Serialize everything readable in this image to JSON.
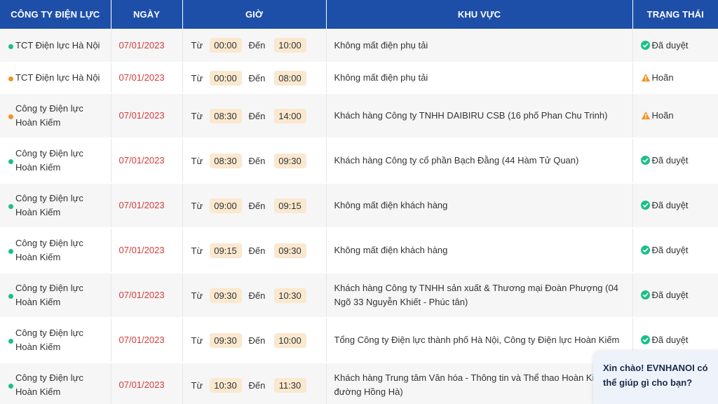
{
  "header": {
    "company": "CÔNG TY ĐIỆN LỰC",
    "date": "NGÀY",
    "time": "GIỜ",
    "area": "KHU VỰC",
    "status": "TRẠNG THÁI"
  },
  "labels": {
    "from": "Từ",
    "to": "Đến"
  },
  "colors": {
    "approved": "#1bbf88",
    "postponed": "#f29322",
    "header_bg": "#1e4fa8",
    "date": "#d63a3a"
  },
  "rows": [
    {
      "company": "TCT Điện lực Hà Nội",
      "dot": "approved",
      "date": "07/01/2023",
      "from": "00:00",
      "to": "10:00",
      "area": "Không mất điện phụ tải",
      "status": "Đã duyệt",
      "status_type": "approved"
    },
    {
      "company": "TCT Điện lực Hà Nội",
      "dot": "postponed",
      "date": "07/01/2023",
      "from": "00:00",
      "to": "08:00",
      "area": "Không mất điện phụ tải",
      "status": "Hoãn",
      "status_type": "postponed"
    },
    {
      "company": "Công ty Điện lực Hoàn Kiếm",
      "dot": "postponed",
      "date": "07/01/2023",
      "from": "08:30",
      "to": "14:00",
      "area": "Khách hàng Công ty TNHH DAIBIRU CSB (16 phố Phan Chu Trinh)",
      "status": "Hoãn",
      "status_type": "postponed"
    },
    {
      "company": "Công ty Điện lực Hoàn Kiếm",
      "dot": "approved",
      "date": "07/01/2023",
      "from": "08:30",
      "to": "09:30",
      "area": "Khách hàng Công ty cổ phần Bạch Đằng (44 Hàm Tử Quan)",
      "status": "Đã duyệt",
      "status_type": "approved"
    },
    {
      "company": "Công ty Điện lực Hoàn Kiếm",
      "dot": "approved",
      "date": "07/01/2023",
      "from": "09:00",
      "to": "09:15",
      "area": "Không mất điện khách hàng",
      "status": "Đã duyệt",
      "status_type": "approved"
    },
    {
      "company": "Công ty Điện lực Hoàn Kiếm",
      "dot": "approved",
      "date": "07/01/2023",
      "from": "09:15",
      "to": "09:30",
      "area": "Không mất điện khách hàng",
      "status": "Đã duyệt",
      "status_type": "approved"
    },
    {
      "company": "Công ty Điện lực Hoàn Kiếm",
      "dot": "approved",
      "date": "07/01/2023",
      "from": "09:30",
      "to": "10:30",
      "area": "Khách hàng Công ty TNHH sản xuất & Thương mại Đoàn Phượng (04 Ngõ 33 Nguyễn Khiết - Phúc tân)",
      "status": "Đã duyệt",
      "status_type": "approved"
    },
    {
      "company": "Công ty Điện lực Hoàn Kiếm",
      "dot": "approved",
      "date": "07/01/2023",
      "from": "09:30",
      "to": "10:00",
      "area": "Tổng Công ty Điện lực thành phố Hà Nội, Công ty Điện lực Hoàn Kiếm",
      "status": "Đã duyệt",
      "status_type": "approved"
    },
    {
      "company": "Công ty Điện lực Hoàn Kiếm",
      "dot": "approved",
      "date": "07/01/2023",
      "from": "10:30",
      "to": "11:30",
      "area": "Khách hàng Trung tâm Văn hóa - Thông tin và Thể thao Hoàn Kiếm đường Hồng Hà)",
      "status": "",
      "status_type": "approved"
    }
  ],
  "chat": {
    "message": "Xin chào! EVNHANOI có thể giúp gì cho bạn?"
  }
}
